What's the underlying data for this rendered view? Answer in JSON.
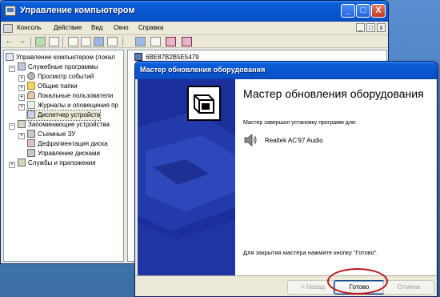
{
  "main_window": {
    "title": "Управление компьютером",
    "controls": {
      "minimize": "_",
      "maximize": "□",
      "close": "X"
    }
  },
  "menu": {
    "items": [
      "Консоль",
      "Действие",
      "Вид",
      "Окно",
      "Справка"
    ],
    "inner_controls": [
      "_",
      "□",
      "x"
    ]
  },
  "toolbar": {
    "icons": [
      "back-arrow-icon",
      "forward-arrow-icon",
      "up-folder-icon",
      "show-tree-icon",
      "properties-icon",
      "export-icon",
      "help-icon",
      "computer-icon",
      "scan-hardware-icon",
      "disable-device-icon",
      "uninstall-device-icon"
    ]
  },
  "tree": {
    "items": [
      {
        "label": "Управление компьютером (локал",
        "expander": "",
        "icon": "computer-icon"
      },
      {
        "label": "Служебные программы",
        "expander": "−",
        "icon": "tools-icon"
      },
      {
        "label": "Просмотр событий",
        "expander": "+",
        "icon": "event-viewer-icon"
      },
      {
        "label": "Общие папки",
        "expander": "+",
        "icon": "folder-icon"
      },
      {
        "label": "Локальные пользователи",
        "expander": "+",
        "icon": "users-icon"
      },
      {
        "label": "Журналы и оповещения пр",
        "expander": "+",
        "icon": "log-icon"
      },
      {
        "label": "Диспетчер устройств",
        "expander": "",
        "icon": "device-manager-icon"
      },
      {
        "label": "Запоминающие устройства",
        "expander": "−",
        "icon": "storage-icon"
      },
      {
        "label": "Съемные ЗУ",
        "expander": "+",
        "icon": "removable-storage-icon"
      },
      {
        "label": "Дефрагментация диска",
        "expander": "",
        "icon": "defrag-icon"
      },
      {
        "label": "Управление дисками",
        "expander": "",
        "icon": "disk-management-icon"
      },
      {
        "label": "Службы и приложения",
        "expander": "+",
        "icon": "services-icon"
      }
    ]
  },
  "right_pane": {
    "device_node": "6BE87B2B5E5479"
  },
  "wizard": {
    "window_title": "Мастер обновления оборудования",
    "heading": "Мастер обновления оборудования",
    "message": "Мастер завершил установку программ для:",
    "device_name": "Realtek AC'97 Audio",
    "close_hint": "Для закрытия мастера нажмите кнопку \"Готово\".",
    "buttons": {
      "back": "< Назад",
      "finish": "Готово",
      "cancel": "Отмена"
    }
  },
  "colors": {
    "titlebar": "#0854d0",
    "banner": "#1b2f9c",
    "highlight": "#c0141e"
  }
}
